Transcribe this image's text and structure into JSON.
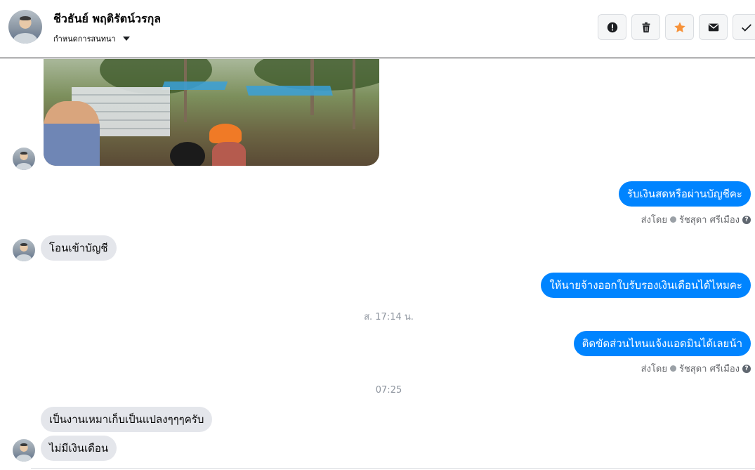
{
  "header": {
    "contact_name": "ชีวธันย์ พฤติรัตน์วรกุล",
    "conversation_settings": "กำหนดการสนทนา",
    "actions": [
      {
        "name": "report-spam",
        "icon": "exclamation-icon"
      },
      {
        "name": "delete",
        "icon": "trash-icon"
      },
      {
        "name": "star",
        "icon": "star-icon",
        "color": "#f7923a"
      },
      {
        "name": "mark-unread",
        "icon": "envelope-icon"
      },
      {
        "name": "mark-done",
        "icon": "check-icon"
      }
    ]
  },
  "messages": {
    "out1": "รับเงินสดหรือผ่านบัญชีคะ",
    "in1": "โอนเข้าบัญชี",
    "out2": "ให้นายจ้างออกใบรับรองเงินเดือนได้ไหมคะ",
    "out3": "ติดขัดส่วนไหนแจ้งแอดมินได้เลยน้า",
    "in2": "เป็นงานเหมาเก็บเป็นแปลงๆๆๆครับ",
    "in3": "ไม่มีเงินเดือน"
  },
  "sent_by": {
    "label": "ส่งโดย",
    "name": "รัชสุดา ศรีเมือง",
    "help": "?"
  },
  "timestamps": {
    "t1": "ส. 17:14 น.",
    "t2": "07:25"
  },
  "colors": {
    "outgoing_bubble": "#0084ff",
    "incoming_bubble": "#e4e6eb",
    "star": "#f7923a"
  }
}
